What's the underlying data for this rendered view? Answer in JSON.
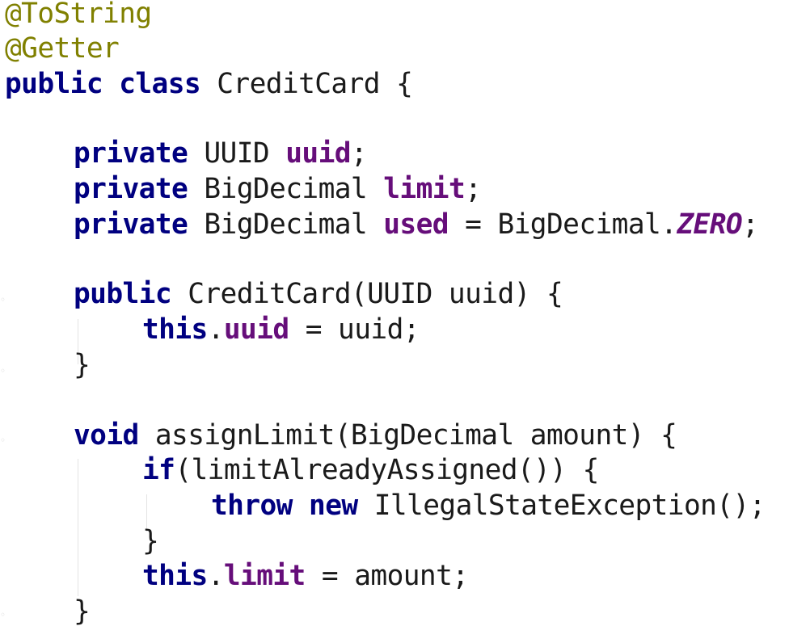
{
  "code_lines": [
    {
      "id": "l1",
      "indent": 0,
      "tokens": [
        {
          "t": "@ToString",
          "c": "ann"
        }
      ]
    },
    {
      "id": "l2",
      "indent": 0,
      "tokens": [
        {
          "t": "@Getter",
          "c": "ann"
        }
      ]
    },
    {
      "id": "l3",
      "indent": 0,
      "tokens": [
        {
          "t": "public",
          "c": "kw"
        },
        {
          "t": " ",
          "c": "plain"
        },
        {
          "t": "class",
          "c": "kw"
        },
        {
          "t": " CreditCard {",
          "c": "plain"
        }
      ]
    },
    {
      "id": "l5",
      "indent": 1,
      "tokens": [
        {
          "t": "private",
          "c": "kw"
        },
        {
          "t": " UUID ",
          "c": "plain"
        },
        {
          "t": "uuid",
          "c": "field"
        },
        {
          "t": ";",
          "c": "plain"
        }
      ]
    },
    {
      "id": "l6",
      "indent": 1,
      "tokens": [
        {
          "t": "private",
          "c": "kw"
        },
        {
          "t": " BigDecimal ",
          "c": "plain"
        },
        {
          "t": "limit",
          "c": "field"
        },
        {
          "t": ";",
          "c": "plain"
        }
      ]
    },
    {
      "id": "l7",
      "indent": 1,
      "tokens": [
        {
          "t": "private",
          "c": "kw"
        },
        {
          "t": " BigDecimal ",
          "c": "plain"
        },
        {
          "t": "used",
          "c": "field"
        },
        {
          "t": " = BigDecimal.",
          "c": "plain"
        },
        {
          "t": "ZERO",
          "c": "const"
        },
        {
          "t": ";",
          "c": "plain"
        }
      ]
    },
    {
      "id": "l9",
      "indent": 1,
      "tokens": [
        {
          "t": "public",
          "c": "kw"
        },
        {
          "t": " CreditCard(UUID uuid) {",
          "c": "plain"
        }
      ]
    },
    {
      "id": "l10",
      "indent": 2,
      "tokens": [
        {
          "t": "this",
          "c": "kw"
        },
        {
          "t": ".",
          "c": "plain"
        },
        {
          "t": "uuid",
          "c": "field"
        },
        {
          "t": " = uuid;",
          "c": "plain"
        }
      ]
    },
    {
      "id": "l11",
      "indent": 1,
      "tokens": [
        {
          "t": "}",
          "c": "plain"
        }
      ]
    },
    {
      "id": "l13",
      "indent": 1,
      "tokens": [
        {
          "t": "void",
          "c": "kw"
        },
        {
          "t": " assignLimit(BigDecimal amount) {",
          "c": "plain"
        }
      ]
    },
    {
      "id": "l14",
      "indent": 2,
      "tokens": [
        {
          "t": "if",
          "c": "kw"
        },
        {
          "t": "(limitAlreadyAssigned()) {",
          "c": "plain"
        }
      ]
    },
    {
      "id": "l15",
      "indent": 3,
      "tokens": [
        {
          "t": "throw",
          "c": "kw"
        },
        {
          "t": " ",
          "c": "plain"
        },
        {
          "t": "new",
          "c": "kw"
        },
        {
          "t": " IllegalStateException();",
          "c": "plain"
        }
      ]
    },
    {
      "id": "l16",
      "indent": 2,
      "tokens": [
        {
          "t": "}",
          "c": "plain"
        }
      ]
    },
    {
      "id": "l17",
      "indent": 2,
      "tokens": [
        {
          "t": "this",
          "c": "kw"
        },
        {
          "t": ".",
          "c": "plain"
        },
        {
          "t": "limit",
          "c": "field"
        },
        {
          "t": " = amount;",
          "c": "plain"
        }
      ]
    },
    {
      "id": "l18",
      "indent": 1,
      "tokens": [
        {
          "t": "}",
          "c": "plain"
        }
      ]
    }
  ],
  "colors": {
    "annotation": "#808000",
    "keyword": "#000080",
    "field": "#660e7a",
    "text": "#1a1a1a",
    "background": "#ffffff"
  }
}
